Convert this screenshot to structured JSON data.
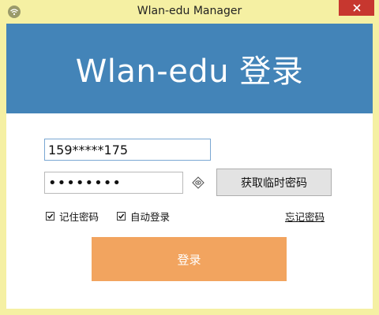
{
  "window": {
    "title": "Wlan-edu Manager",
    "app_icon": "wifi-icon",
    "close_icon": "close-icon",
    "frame_color": "#f5f0a3",
    "close_color": "#c7372f"
  },
  "banner": {
    "title": "Wlan-edu 登录",
    "color": "#4384b8"
  },
  "form": {
    "username_value": "159*****175",
    "password_value": "••••••••",
    "eye_icon": "eye-icon",
    "temp_password_label": "获取临时密码",
    "remember_password_label": "记住密码",
    "remember_password_checked": true,
    "auto_login_label": "自动登录",
    "auto_login_checked": true,
    "forgot_password_label": "忘记密码",
    "login_label": "登录",
    "login_color": "#f2a45f"
  }
}
